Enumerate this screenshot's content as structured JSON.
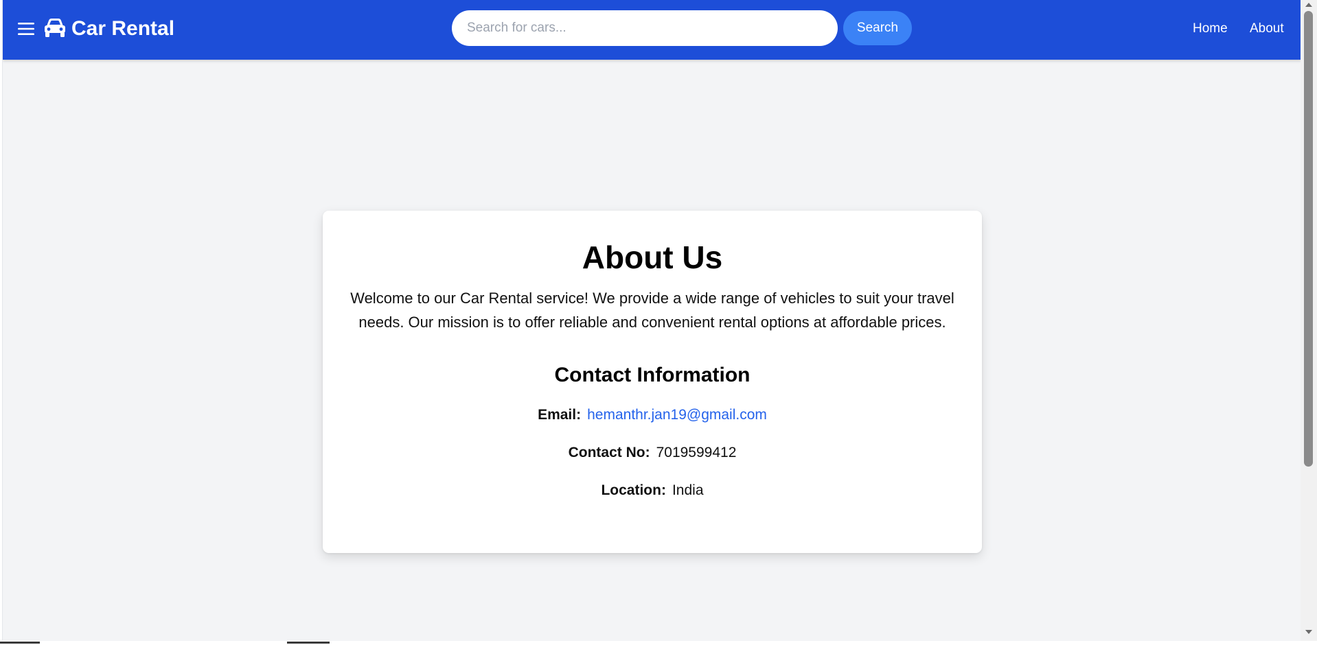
{
  "navbar": {
    "brand": "Car Rental",
    "menu_icon": "hamburger-menu-icon",
    "brand_icon": "car-icon",
    "search": {
      "placeholder": "Search for cars...",
      "value": "",
      "button_label": "Search"
    },
    "links": [
      {
        "label": "Home"
      },
      {
        "label": "About"
      }
    ],
    "colors": {
      "background": "#1d4ed8",
      "search_button": "#3b82f6"
    }
  },
  "about": {
    "title": "About Us",
    "intro": "Welcome to our Car Rental service! We provide a wide range of vehicles to suit your travel needs. Our mission is to offer reliable and convenient rental options at affordable prices.",
    "contact_heading": "Contact Information",
    "contact": {
      "email_label": "Email:",
      "email_value": "hemanthr.jan19@gmail.com",
      "phone_label": "Contact No:",
      "phone_value": "7019599412",
      "location_label": "Location:",
      "location_value": "India"
    },
    "colors": {
      "page_background": "#f3f4f6",
      "link": "#2563eb"
    }
  }
}
